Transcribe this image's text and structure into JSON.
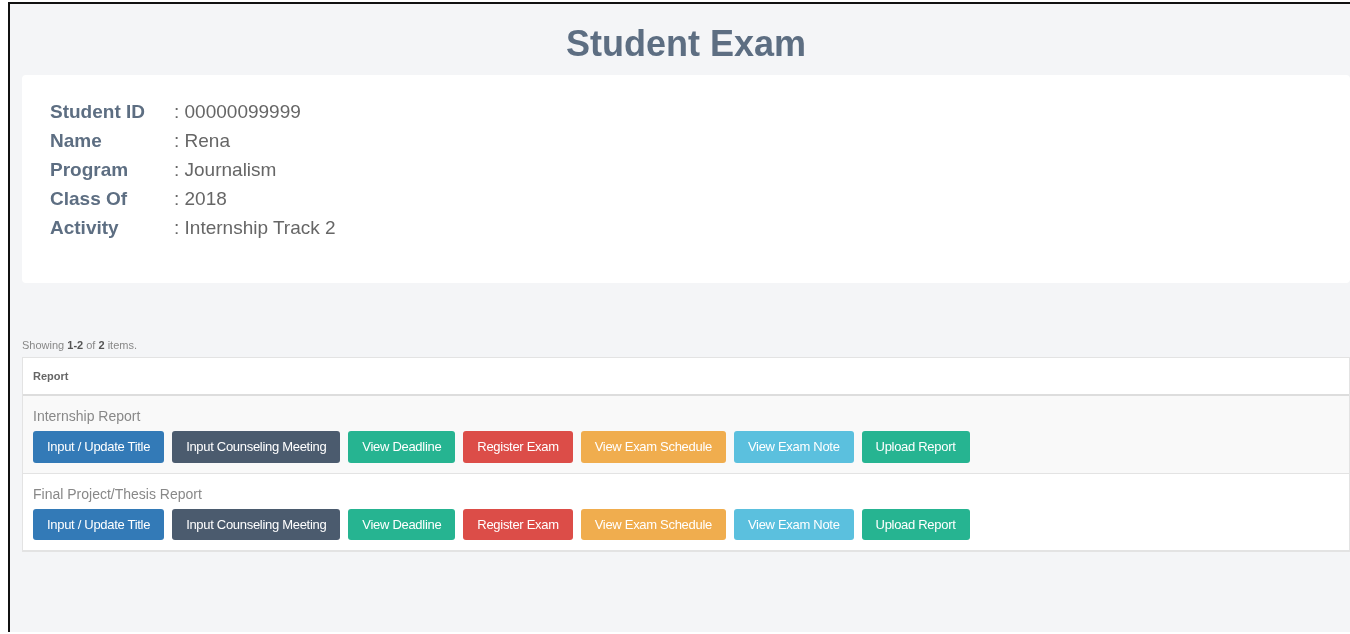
{
  "title": "Student Exam",
  "student": [
    {
      "label": "Student ID",
      "value": ": 00000099999"
    },
    {
      "label": "Name",
      "value": ": Rena"
    },
    {
      "label": "Program",
      "value": ": Journalism"
    },
    {
      "label": "Class Of",
      "value": ": 2018"
    },
    {
      "label": "Activity",
      "value": ": Internship Track 2"
    }
  ],
  "summary": "Showing **1-2** of **2** items.",
  "table": {
    "columns": [
      "Report"
    ],
    "rows": [
      {
        "report": "Internship Report",
        "buttons": [
          {
            "label": "Input / Update Title",
            "kind": "primary"
          },
          {
            "label": "Input Counseling Meeting",
            "kind": "dark"
          },
          {
            "label": "View Deadline",
            "kind": "success"
          },
          {
            "label": "Register Exam",
            "kind": "danger"
          },
          {
            "label": "View Exam Schedule",
            "kind": "warning"
          },
          {
            "label": "View Exam Note",
            "kind": "info"
          },
          {
            "label": "Upload Report",
            "kind": "success"
          }
        ]
      },
      {
        "report": "Final Project/Thesis Report",
        "buttons": [
          {
            "label": "Input / Update Title",
            "kind": "primary"
          },
          {
            "label": "Input Counseling Meeting",
            "kind": "dark"
          },
          {
            "label": "View Deadline",
            "kind": "success"
          },
          {
            "label": "Register Exam",
            "kind": "danger"
          },
          {
            "label": "View Exam Schedule",
            "kind": "warning"
          },
          {
            "label": "View Exam Note",
            "kind": "info"
          },
          {
            "label": "Upload Report",
            "kind": "success"
          }
        ]
      }
    ]
  }
}
